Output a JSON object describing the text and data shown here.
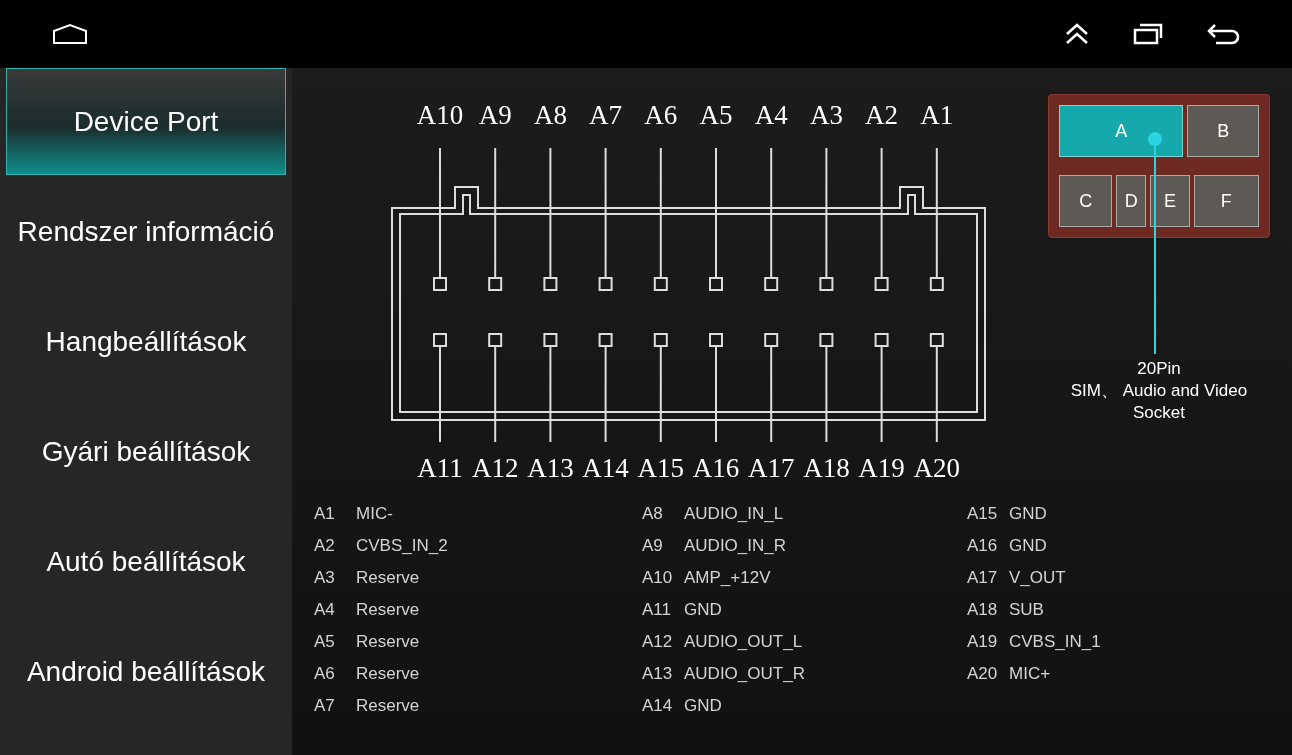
{
  "sidebar": {
    "items": [
      {
        "label": "Device Port",
        "selected": true
      },
      {
        "label": "Rendszer információ",
        "selected": false
      },
      {
        "label": "Hangbeállítások",
        "selected": false
      },
      {
        "label": "Gyári beállítások",
        "selected": false
      },
      {
        "label": "Autó beállítások",
        "selected": false
      },
      {
        "label": "Android beállítások",
        "selected": false
      }
    ]
  },
  "connector": {
    "top_pins": [
      "A10",
      "A9",
      "A8",
      "A7",
      "A6",
      "A5",
      "A4",
      "A3",
      "A2",
      "A1"
    ],
    "bottom_pins": [
      "A11",
      "A12",
      "A13",
      "A14",
      "A15",
      "A16",
      "A17",
      "A18",
      "A19",
      "A20"
    ]
  },
  "socket_rows": [
    [
      {
        "label": "A",
        "selected": true
      },
      {
        "label": "B",
        "selected": false
      }
    ],
    [
      {
        "label": "C",
        "selected": false
      },
      {
        "label": "D",
        "selected": false
      },
      {
        "label": "E",
        "selected": false
      },
      {
        "label": "F",
        "selected": false
      }
    ]
  ],
  "socket_caption": [
    "20Pin",
    "SIM、 Audio and Video",
    "Socket"
  ],
  "pin_list": [
    {
      "pin": "A1",
      "signal": "MIC-"
    },
    {
      "pin": "A2",
      "signal": "CVBS_IN_2"
    },
    {
      "pin": "A3",
      "signal": "Reserve"
    },
    {
      "pin": "A4",
      "signal": "Reserve"
    },
    {
      "pin": "A5",
      "signal": "Reserve"
    },
    {
      "pin": "A6",
      "signal": "Reserve"
    },
    {
      "pin": "A7",
      "signal": "Reserve"
    },
    {
      "pin": "A8",
      "signal": "AUDIO_IN_L"
    },
    {
      "pin": "A9",
      "signal": "AUDIO_IN_R"
    },
    {
      "pin": "A10",
      "signal": "AMP_+12V"
    },
    {
      "pin": "A11",
      "signal": "GND"
    },
    {
      "pin": "A12",
      "signal": "AUDIO_OUT_L"
    },
    {
      "pin": "A13",
      "signal": "AUDIO_OUT_R"
    },
    {
      "pin": "A14",
      "signal": "GND"
    },
    {
      "pin": "A15",
      "signal": "GND"
    },
    {
      "pin": "A16",
      "signal": "GND"
    },
    {
      "pin": "A17",
      "signal": "V_OUT"
    },
    {
      "pin": "A18",
      "signal": "SUB"
    },
    {
      "pin": "A19",
      "signal": "CVBS_IN_1"
    },
    {
      "pin": "A20",
      "signal": "MIC+"
    }
  ]
}
